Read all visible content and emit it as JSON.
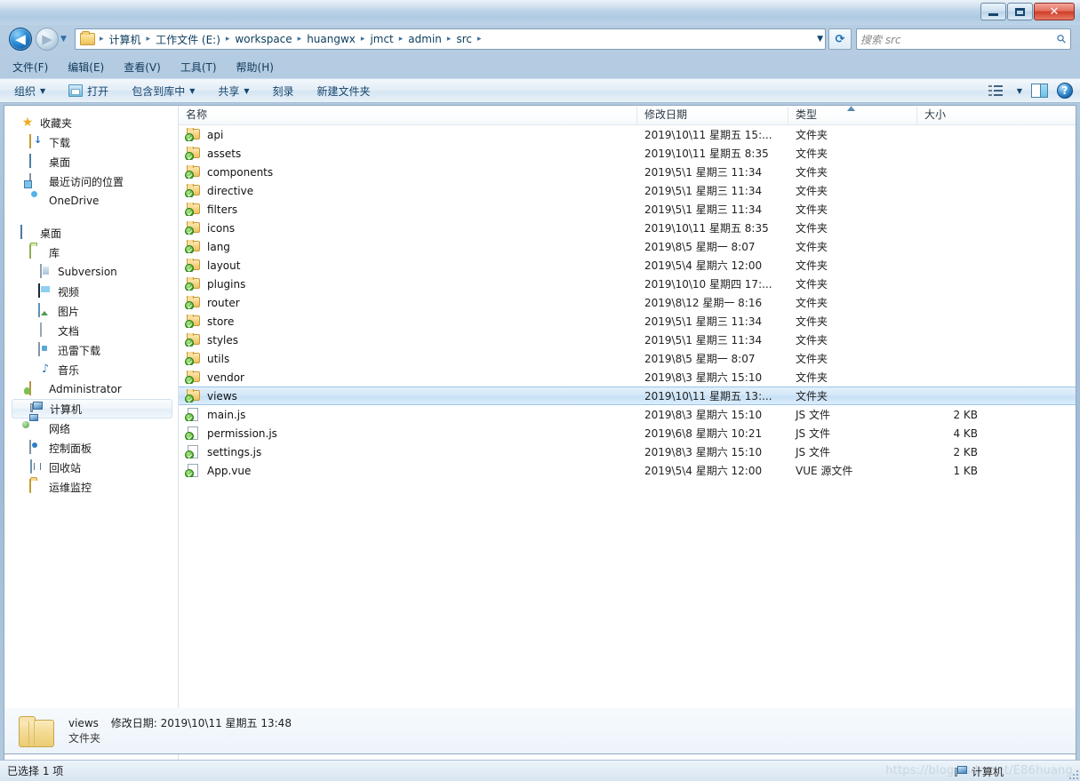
{
  "window": {
    "minimize_label": "minimize",
    "maximize_label": "maximize",
    "close_label": "✕"
  },
  "address": {
    "back_label": "◀",
    "forward_label": "▶",
    "history_label": "▼",
    "folder_icon": "folder-icon",
    "crumbs": [
      "计算机",
      "工作文件 (E:)",
      "workspace",
      "huangwx",
      "jmct",
      "admin",
      "src"
    ],
    "separator": "▸",
    "dropdown_label": "▼",
    "refresh_label": "⟳"
  },
  "search": {
    "placeholder": "搜索 src",
    "value": "",
    "icon": "search-icon"
  },
  "menubar": {
    "items": [
      "文件(F)",
      "编辑(E)",
      "查看(V)",
      "工具(T)",
      "帮助(H)"
    ]
  },
  "toolbar": {
    "organize": "组织",
    "open": "打开",
    "include_in_library": "包含到库中",
    "share": "共享",
    "burn": "刻录",
    "new_folder": "新建文件夹",
    "caret": "▼",
    "view_dropdown_caret": "▼",
    "help_label": "?"
  },
  "sidebar": {
    "groups": [
      {
        "items": [
          {
            "label": "收藏夹",
            "icon": "star-icon",
            "level": 0
          },
          {
            "label": "下载",
            "icon": "download-icon",
            "level": 1
          },
          {
            "label": "桌面",
            "icon": "desktop-icon",
            "level": 1
          },
          {
            "label": "最近访问的位置",
            "icon": "recent-places-icon",
            "level": 1
          },
          {
            "label": "OneDrive",
            "icon": "onedrive-icon",
            "level": 1
          }
        ]
      },
      {
        "items": [
          {
            "label": "桌面",
            "icon": "desktop-icon",
            "level": 0
          },
          {
            "label": "库",
            "icon": "library-icon",
            "level": 1
          },
          {
            "label": "Subversion",
            "icon": "subversion-icon",
            "level": 2
          },
          {
            "label": "视频",
            "icon": "video-icon",
            "level": 2
          },
          {
            "label": "图片",
            "icon": "picture-icon",
            "level": 2
          },
          {
            "label": "文档",
            "icon": "document-icon",
            "level": 2
          },
          {
            "label": "迅雷下载",
            "icon": "thunder-download-icon",
            "level": 2
          },
          {
            "label": "音乐",
            "icon": "music-icon",
            "level": 2
          },
          {
            "label": "Administrator",
            "icon": "user-icon",
            "level": 1
          },
          {
            "label": "计算机",
            "icon": "computer-icon",
            "level": 1,
            "selected": true
          },
          {
            "label": "网络",
            "icon": "network-icon",
            "level": 1
          },
          {
            "label": "控制面板",
            "icon": "control-panel-icon",
            "level": 1
          },
          {
            "label": "回收站",
            "icon": "recycle-bin-icon",
            "level": 1
          },
          {
            "label": "运维监控",
            "icon": "folder-icon",
            "level": 1
          }
        ]
      }
    ]
  },
  "filelist": {
    "columns": [
      {
        "label": "名称",
        "key": "name"
      },
      {
        "label": "修改日期",
        "key": "date"
      },
      {
        "label": "类型",
        "key": "type"
      },
      {
        "label": "大小",
        "key": "size"
      }
    ],
    "sort_indicator": "ascending",
    "rows": [
      {
        "name": "api",
        "date": "2019\\10\\11 星期五 15:...",
        "type": "文件夹",
        "size": "",
        "kind": "folder"
      },
      {
        "name": "assets",
        "date": "2019\\10\\11 星期五 8:35",
        "type": "文件夹",
        "size": "",
        "kind": "folder"
      },
      {
        "name": "components",
        "date": "2019\\5\\1 星期三 11:34",
        "type": "文件夹",
        "size": "",
        "kind": "folder"
      },
      {
        "name": "directive",
        "date": "2019\\5\\1 星期三 11:34",
        "type": "文件夹",
        "size": "",
        "kind": "folder"
      },
      {
        "name": "filters",
        "date": "2019\\5\\1 星期三 11:34",
        "type": "文件夹",
        "size": "",
        "kind": "folder"
      },
      {
        "name": "icons",
        "date": "2019\\10\\11 星期五 8:35",
        "type": "文件夹",
        "size": "",
        "kind": "folder"
      },
      {
        "name": "lang",
        "date": "2019\\8\\5 星期一 8:07",
        "type": "文件夹",
        "size": "",
        "kind": "folder"
      },
      {
        "name": "layout",
        "date": "2019\\5\\4 星期六 12:00",
        "type": "文件夹",
        "size": "",
        "kind": "folder"
      },
      {
        "name": "plugins",
        "date": "2019\\10\\10 星期四 17:...",
        "type": "文件夹",
        "size": "",
        "kind": "folder"
      },
      {
        "name": "router",
        "date": "2019\\8\\12 星期一 8:16",
        "type": "文件夹",
        "size": "",
        "kind": "folder"
      },
      {
        "name": "store",
        "date": "2019\\5\\1 星期三 11:34",
        "type": "文件夹",
        "size": "",
        "kind": "folder"
      },
      {
        "name": "styles",
        "date": "2019\\5\\1 星期三 11:34",
        "type": "文件夹",
        "size": "",
        "kind": "folder"
      },
      {
        "name": "utils",
        "date": "2019\\8\\5 星期一 8:07",
        "type": "文件夹",
        "size": "",
        "kind": "folder"
      },
      {
        "name": "vendor",
        "date": "2019\\8\\3 星期六 15:10",
        "type": "文件夹",
        "size": "",
        "kind": "folder"
      },
      {
        "name": "views",
        "date": "2019\\10\\11 星期五 13:...",
        "type": "文件夹",
        "size": "",
        "kind": "folder",
        "selected": true
      },
      {
        "name": "main.js",
        "date": "2019\\8\\3 星期六 15:10",
        "type": "JS 文件",
        "size": "2 KB",
        "kind": "file"
      },
      {
        "name": "permission.js",
        "date": "2019\\6\\8 星期六 10:21",
        "type": "JS 文件",
        "size": "4 KB",
        "kind": "file"
      },
      {
        "name": "settings.js",
        "date": "2019\\8\\3 星期六 15:10",
        "type": "JS 文件",
        "size": "2 KB",
        "kind": "file"
      },
      {
        "name": "App.vue",
        "date": "2019\\5\\4 星期六 12:00",
        "type": "VUE 源文件",
        "size": "1 KB",
        "kind": "file"
      }
    ]
  },
  "details": {
    "name": "views",
    "date_label": "修改日期: 2019\\10\\11 星期五 13:48",
    "type": "文件夹",
    "icon": "folder-large-icon"
  },
  "statusbar": {
    "text": "已选择 1 项",
    "watermark_url": "https://blog.csdn.net/E86huang",
    "watermark_label": "计算机"
  },
  "colors": {
    "accent": "#1b6fb5",
    "selection": "#c6e0f6",
    "chrome": "#a8c3dd",
    "svn_green": "#5bb83a",
    "folder_yellow": "#f1c868"
  }
}
